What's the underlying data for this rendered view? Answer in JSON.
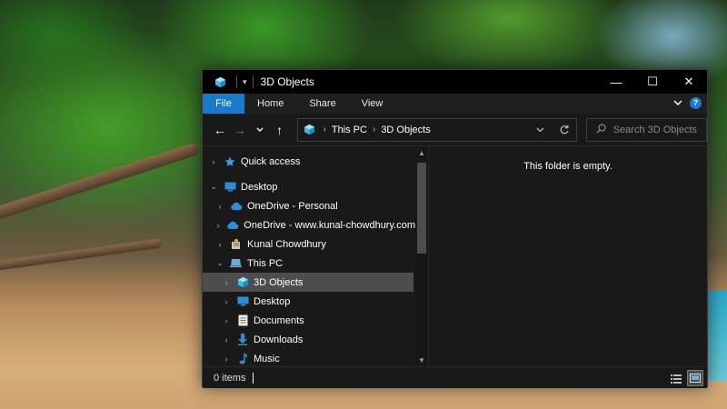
{
  "window": {
    "title": "3D Objects",
    "controls": {
      "minimize": "—",
      "maximize": "☐",
      "close": "✕"
    }
  },
  "ribbon": {
    "tabs": [
      {
        "label": "File",
        "active": true
      },
      {
        "label": "Home"
      },
      {
        "label": "Share"
      },
      {
        "label": "View"
      }
    ],
    "help": "?"
  },
  "navigation": {
    "back": "←",
    "forward": "→",
    "recent": "⌄",
    "up": "↑"
  },
  "address": {
    "crumbs": [
      "This PC",
      "3D Objects"
    ]
  },
  "search": {
    "placeholder": "Search 3D Objects"
  },
  "tree": [
    {
      "label": "Quick access",
      "icon": "star-icon",
      "level": 0,
      "expanded": false
    },
    {
      "label": "Desktop",
      "icon": "desktop-icon",
      "level": 0,
      "expanded": true
    },
    {
      "label": "OneDrive - Personal",
      "icon": "cloud-icon",
      "level": 1,
      "expanded": false
    },
    {
      "label": "OneDrive - www.kunal-chowdhury.com",
      "icon": "cloud-icon",
      "level": 1,
      "expanded": false
    },
    {
      "label": "Kunal Chowdhury",
      "icon": "user-folder-icon",
      "level": 1,
      "expanded": false
    },
    {
      "label": "This PC",
      "icon": "computer-icon",
      "level": 1,
      "expanded": true
    },
    {
      "label": "3D Objects",
      "icon": "cube-icon",
      "level": 2,
      "expanded": false,
      "selected": true
    },
    {
      "label": "Desktop",
      "icon": "desktop-icon",
      "level": 2,
      "expanded": false
    },
    {
      "label": "Documents",
      "icon": "documents-icon",
      "level": 2,
      "expanded": false
    },
    {
      "label": "Downloads",
      "icon": "downloads-icon",
      "level": 2,
      "expanded": false
    },
    {
      "label": "Music",
      "icon": "music-icon",
      "level": 2,
      "expanded": false
    }
  ],
  "content": {
    "empty_message": "This folder is empty."
  },
  "status": {
    "items": "0 items"
  },
  "colors": {
    "accent": "#1979ca",
    "selection": "#4d4d4d",
    "background": "#191919"
  }
}
